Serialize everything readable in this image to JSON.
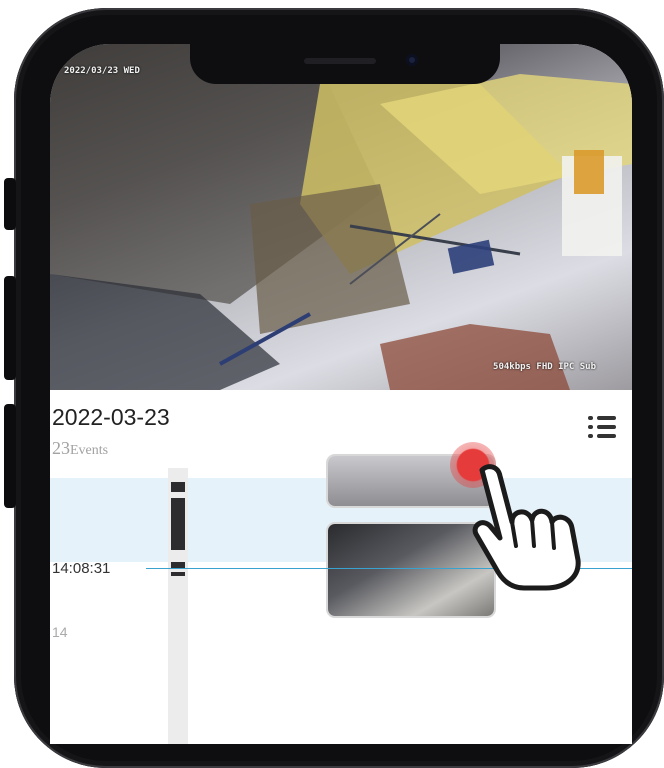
{
  "video": {
    "osd_datetime": "2022/03/23  WED",
    "osd_stream": "504kbps FHD IPC Sub"
  },
  "events": {
    "date": "2022-03-23",
    "count_number": "23",
    "count_label": "Events"
  },
  "timeline": {
    "current_time": "14:08:31",
    "hour_marker": "14"
  },
  "icons": [
    "list-icon",
    "record-button-icon",
    "tap-hand-icon"
  ],
  "colors": {
    "now_line": "#3aa2cf",
    "band": "#e6f2f9",
    "record": "#e63b3b"
  }
}
